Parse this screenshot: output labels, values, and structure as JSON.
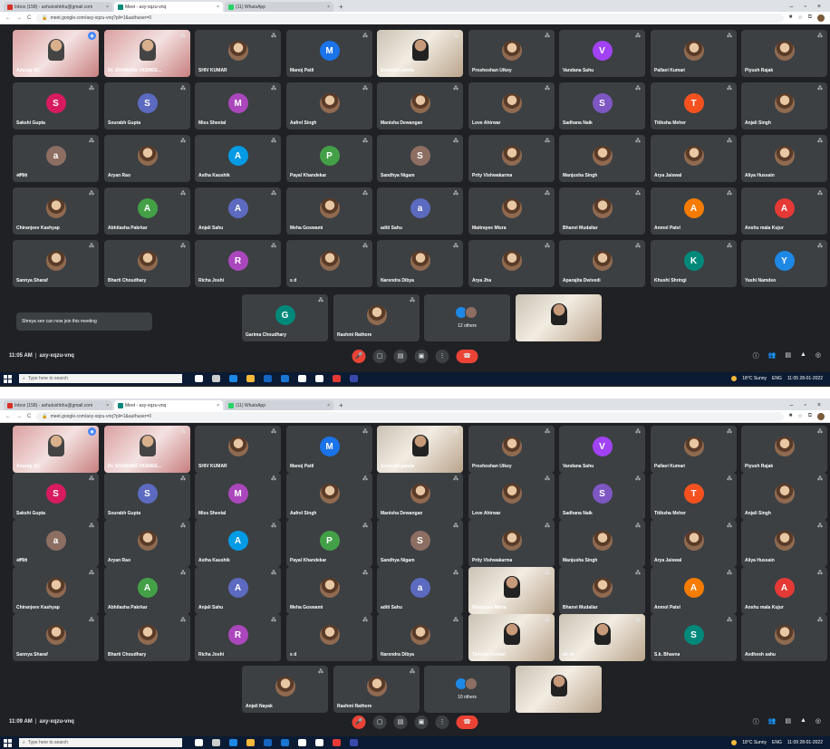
{
  "browser": {
    "tabs": [
      {
        "title": "Inbox (158) - ashutoshbhu@gmail.com",
        "favicon_color": "#d93025",
        "active": false
      },
      {
        "title": "Meet - axy-xqzu-vnq",
        "favicon_color": "#00897b",
        "active": true
      },
      {
        "title": "(11) WhatsApp",
        "favicon_color": "#25d366",
        "active": false
      }
    ],
    "new_tab_glyph": "+",
    "url_top": "meet.google.com/axy-xqzu-vnq?pli=1&authuser=0",
    "url_bottom": "meet.google.com/axy-xqzu-vnq?pli=1&authuser=0"
  },
  "meeting": {
    "code": "axy-xqzu-vnq",
    "time_top": "11:05 AM",
    "time_bottom": "11:09 AM",
    "toast_top": "Shreya sen can now join this meeting",
    "others_top": "12 others",
    "others_bottom": "10 others"
  },
  "participants_top": [
    {
      "name": "Anurag AC",
      "kind": "video-red",
      "pinned": true
    },
    {
      "name": "Dr. SHABANA YASMEE...",
      "kind": "video-red"
    },
    {
      "name": "SHIV KUMAR",
      "kind": "photo"
    },
    {
      "name": "Manoj Patil",
      "kind": "letter",
      "letter": "M",
      "color": "#1a73e8"
    },
    {
      "name": "Somenjit panda",
      "kind": "video-highlight"
    },
    {
      "name": "Proshoshan Uikey",
      "kind": "photo"
    },
    {
      "name": "Vandana Sahu",
      "kind": "letter",
      "letter": "V",
      "color": "#a142f4"
    },
    {
      "name": "Pallavi Kumari",
      "kind": "photo"
    },
    {
      "name": "Piyush Rajak",
      "kind": "photo"
    },
    {
      "name": "Sakshi Gupta",
      "kind": "letter",
      "letter": "S",
      "color": "#d81b60"
    },
    {
      "name": "Sourabh Gupta",
      "kind": "letter",
      "letter": "S",
      "color": "#5c6bc0"
    },
    {
      "name": "Miss Sheetal",
      "kind": "letter",
      "letter": "M",
      "color": "#ab47bc"
    },
    {
      "name": "Aafrel Singh",
      "kind": "photo"
    },
    {
      "name": "Manisha Dewangan",
      "kind": "photo"
    },
    {
      "name": "Love Ahirwar",
      "kind": "photo"
    },
    {
      "name": "Sadhana Naik",
      "kind": "letter",
      "letter": "S",
      "color": "#7e57c2"
    },
    {
      "name": "Titiksha Meher",
      "kind": "letter",
      "letter": "T",
      "color": "#f4511e"
    },
    {
      "name": "Anjali Singh",
      "kind": "photo"
    },
    {
      "name": "अर्पिता",
      "kind": "letter",
      "letter": "a",
      "color": "#8d6e63"
    },
    {
      "name": "Aryan Rao",
      "kind": "photo"
    },
    {
      "name": "Astha Kaushik",
      "kind": "letter",
      "letter": "A",
      "color": "#039be5"
    },
    {
      "name": "Payal Khandekar",
      "kind": "letter",
      "letter": "P",
      "color": "#43a047"
    },
    {
      "name": "Sandhya Nigam",
      "kind": "letter",
      "letter": "S",
      "color": "#8d6e63"
    },
    {
      "name": "Prity Vishwakarma",
      "kind": "photo"
    },
    {
      "name": "Manjusha Singh",
      "kind": "photo"
    },
    {
      "name": "Arya Jaiswal",
      "kind": "photo"
    },
    {
      "name": "Aliya Hussain",
      "kind": "photo"
    },
    {
      "name": "Chiranjeev Kashyap",
      "kind": "photo"
    },
    {
      "name": "Abhilasha Pakrkar",
      "kind": "letter",
      "letter": "A",
      "color": "#43a047"
    },
    {
      "name": "Anjali Sahu",
      "kind": "letter",
      "letter": "A",
      "color": "#5c6bc0"
    },
    {
      "name": "Meha Goswami",
      "kind": "photo"
    },
    {
      "name": "aditi Sahu",
      "kind": "letter",
      "letter": "a",
      "color": "#5c6bc0"
    },
    {
      "name": "Maitrayee Misra",
      "kind": "photo"
    },
    {
      "name": "Bhanvi Mudaliar",
      "kind": "photo"
    },
    {
      "name": "Anmol Patel",
      "kind": "letter",
      "letter": "A",
      "color": "#f57c00"
    },
    {
      "name": "Anshu mala Kujur",
      "kind": "letter",
      "letter": "A",
      "color": "#e53935"
    },
    {
      "name": "Sannya Sharaf",
      "kind": "photo"
    },
    {
      "name": "Bharti Choudhary",
      "kind": "photo"
    },
    {
      "name": "Richa Joshi",
      "kind": "letter",
      "letter": "R",
      "color": "#ab47bc"
    },
    {
      "name": "s d",
      "kind": "photo"
    },
    {
      "name": "Narendra Dibya",
      "kind": "photo"
    },
    {
      "name": "Arya Jha",
      "kind": "photo"
    },
    {
      "name": "Aparajita Dwivedi",
      "kind": "photo"
    },
    {
      "name": "Khushi Shringi",
      "kind": "letter",
      "letter": "K",
      "color": "#00897b"
    },
    {
      "name": "Yashi Namdeo",
      "kind": "letter",
      "letter": "Y",
      "color": "#1e88e5"
    }
  ],
  "participants_top_last_row": [
    {
      "name": "Garima Choudhary",
      "kind": "letter",
      "letter": "G",
      "color": "#00897b"
    },
    {
      "name": "Rashmi Rathore",
      "kind": "photo"
    },
    {
      "name": "",
      "kind": "others"
    },
    {
      "name": "",
      "kind": "video"
    }
  ],
  "participants_bottom": [
    {
      "name": "Anurag AC",
      "kind": "video-red",
      "pinned": true
    },
    {
      "name": "Dr. SHABANA YASMEE...",
      "kind": "video-red"
    },
    {
      "name": "SHIV KUMAR",
      "kind": "photo"
    },
    {
      "name": "Manoj Patil",
      "kind": "letter",
      "letter": "M",
      "color": "#1a73e8"
    },
    {
      "name": "Somenjit panda",
      "kind": "video-highlight"
    },
    {
      "name": "Proshoshan Uikey",
      "kind": "photo"
    },
    {
      "name": "Vandana Sahu",
      "kind": "letter",
      "letter": "V",
      "color": "#a142f4"
    },
    {
      "name": "Pallavi Kumari",
      "kind": "photo"
    },
    {
      "name": "Piyush Rajak",
      "kind": "photo"
    },
    {
      "name": "Sakshi Gupta",
      "kind": "letter",
      "letter": "S",
      "color": "#d81b60"
    },
    {
      "name": "Sourabh Gupta",
      "kind": "letter",
      "letter": "S",
      "color": "#5c6bc0"
    },
    {
      "name": "Miss Sheetal",
      "kind": "letter",
      "letter": "M",
      "color": "#ab47bc"
    },
    {
      "name": "Aafrel Singh",
      "kind": "photo"
    },
    {
      "name": "Manisha Dewangan",
      "kind": "photo"
    },
    {
      "name": "Love Ahirwar",
      "kind": "photo"
    },
    {
      "name": "Sadhana Naik",
      "kind": "letter",
      "letter": "S",
      "color": "#7e57c2"
    },
    {
      "name": "Titiksha Meher",
      "kind": "letter",
      "letter": "T",
      "color": "#f4511e"
    },
    {
      "name": "Anjali Singh",
      "kind": "photo"
    },
    {
      "name": "अर्पिता",
      "kind": "letter",
      "letter": "a",
      "color": "#8d6e63"
    },
    {
      "name": "Aryan Rao",
      "kind": "photo"
    },
    {
      "name": "Astha Kaushik",
      "kind": "letter",
      "letter": "A",
      "color": "#039be5"
    },
    {
      "name": "Payal Khandekar",
      "kind": "letter",
      "letter": "P",
      "color": "#43a047"
    },
    {
      "name": "Sandhya Nigam",
      "kind": "letter",
      "letter": "S",
      "color": "#8d6e63"
    },
    {
      "name": "Prity Vishwakarma",
      "kind": "photo"
    },
    {
      "name": "Manjusha Singh",
      "kind": "photo"
    },
    {
      "name": "Arya Jaiswal",
      "kind": "photo"
    },
    {
      "name": "Aliya Hussain",
      "kind": "photo"
    },
    {
      "name": "Chiranjeev Kashyap",
      "kind": "photo"
    },
    {
      "name": "Abhilasha Pakrkar",
      "kind": "letter",
      "letter": "A",
      "color": "#43a047"
    },
    {
      "name": "Anjali Sahu",
      "kind": "letter",
      "letter": "A",
      "color": "#5c6bc0"
    },
    {
      "name": "Meha Goswami",
      "kind": "photo"
    },
    {
      "name": "aditi Sahu",
      "kind": "letter",
      "letter": "a",
      "color": "#5c6bc0"
    },
    {
      "name": "Maitrayee Misra",
      "kind": "video"
    },
    {
      "name": "Bhanvi Mudaliar",
      "kind": "photo"
    },
    {
      "name": "Anmol Patel",
      "kind": "letter",
      "letter": "A",
      "color": "#f57c00"
    },
    {
      "name": "Anshu mala Kujur",
      "kind": "letter",
      "letter": "A",
      "color": "#e53935"
    },
    {
      "name": "Sannya Sharaf",
      "kind": "photo"
    },
    {
      "name": "Bharti Choudhary",
      "kind": "photo"
    },
    {
      "name": "Richa Joshi",
      "kind": "letter",
      "letter": "R",
      "color": "#ab47bc"
    },
    {
      "name": "s d",
      "kind": "photo"
    },
    {
      "name": "Narendra Dibya",
      "kind": "photo"
    },
    {
      "name": "Tanisha Kumari",
      "kind": "video"
    },
    {
      "name": "vk vk",
      "kind": "video"
    },
    {
      "name": "S.k. Bhavna",
      "kind": "letter",
      "letter": "S",
      "color": "#00897b"
    },
    {
      "name": "Avdhesh sahu",
      "kind": "photo"
    }
  ],
  "participants_bottom_last_row": [
    {
      "name": "Anjali Nayak",
      "kind": "photo"
    },
    {
      "name": "Rashmi Rathore",
      "kind": "photo"
    },
    {
      "name": "",
      "kind": "others"
    },
    {
      "name": "",
      "kind": "video"
    }
  ],
  "taskbar": {
    "search_placeholder": "Type here to search",
    "weather": "18°C Sunny",
    "lang": "ENG",
    "clock_top": "11:05",
    "clock_bottom": "11:09",
    "date": "28-01-2022"
  },
  "icons": {
    "mic_off": "🎤",
    "camera": "📷",
    "captions": "cc",
    "present": "⬆",
    "more": "⋮",
    "end_call": "☎",
    "info": "ⓘ",
    "people": "👥",
    "chat": "💬",
    "activities": "⚛"
  }
}
